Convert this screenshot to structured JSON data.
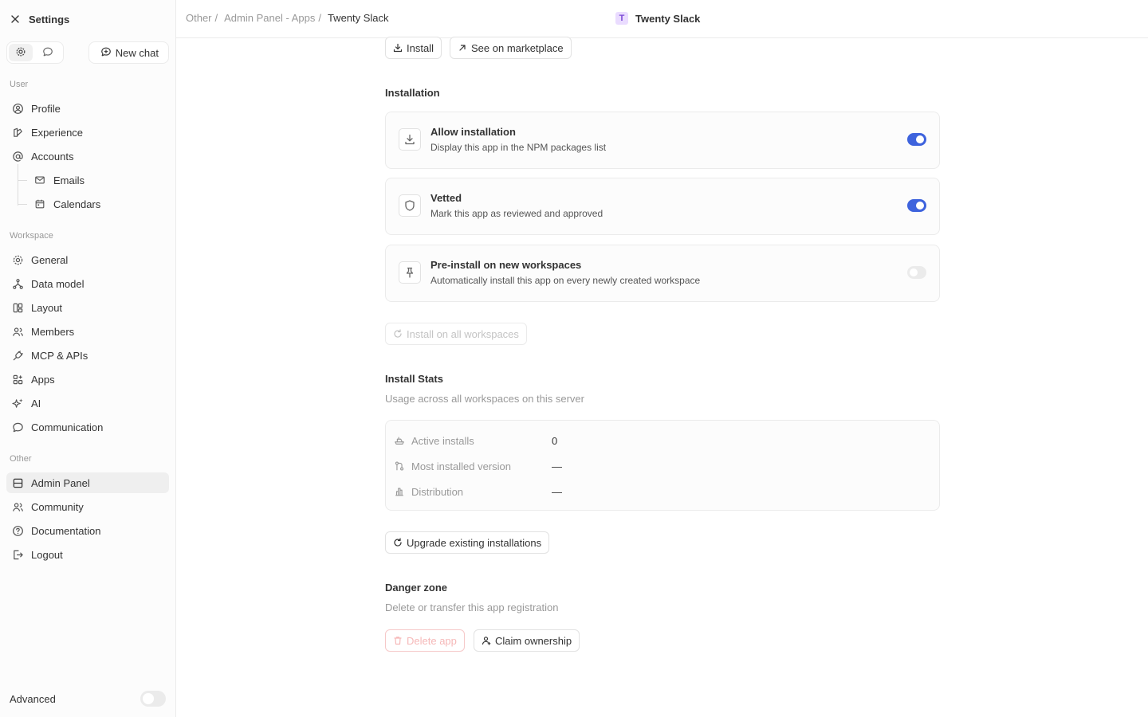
{
  "sidebar": {
    "title": "Settings",
    "new_chat": "New chat",
    "sections": {
      "user": "User",
      "workspace": "Workspace",
      "other": "Other"
    },
    "user_items": {
      "profile": "Profile",
      "experience": "Experience",
      "accounts": "Accounts",
      "emails": "Emails",
      "calendars": "Calendars"
    },
    "workspace_items": {
      "general": "General",
      "data_model": "Data model",
      "layout": "Layout",
      "members": "Members",
      "mcp_apis": "MCP & APIs",
      "apps": "Apps",
      "ai": "AI",
      "communication": "Communication"
    },
    "other_items": {
      "admin_panel": "Admin Panel",
      "community": "Community",
      "documentation": "Documentation",
      "logout": "Logout"
    },
    "advanced": "Advanced",
    "advanced_on": false
  },
  "topbar": {
    "crumb_1": "Other",
    "crumb_2": "Admin Panel - Apps",
    "crumb_3": "Twenty Slack",
    "separator": "/",
    "app_badge": "T",
    "app_title": "Twenty Slack"
  },
  "actions": {
    "install": "Install",
    "marketplace": "See on marketplace"
  },
  "installation": {
    "title": "Installation",
    "allow": {
      "title": "Allow installation",
      "desc": "Display this app in the NPM packages list",
      "on": true
    },
    "vetted": {
      "title": "Vetted",
      "desc": "Mark this app as reviewed and approved",
      "on": true
    },
    "preinstall": {
      "title": "Pre-install on new workspaces",
      "desc": "Automatically install this app on every newly created workspace",
      "on": false
    },
    "install_all": "Install on all workspaces"
  },
  "stats": {
    "title": "Install Stats",
    "subtitle": "Usage across all workspaces on this server",
    "active_label": "Active installs",
    "active_value": "0",
    "version_label": "Most installed version",
    "version_value": "—",
    "distribution_label": "Distribution",
    "distribution_value": "—",
    "upgrade": "Upgrade existing installations"
  },
  "danger": {
    "title": "Danger zone",
    "subtitle": "Delete or transfer this app registration",
    "delete": "Delete app",
    "claim": "Claim ownership"
  },
  "colors": {
    "accent": "#3e63dd",
    "danger_disabled": "#f6b8b8",
    "badge_bg": "#eadcff"
  }
}
